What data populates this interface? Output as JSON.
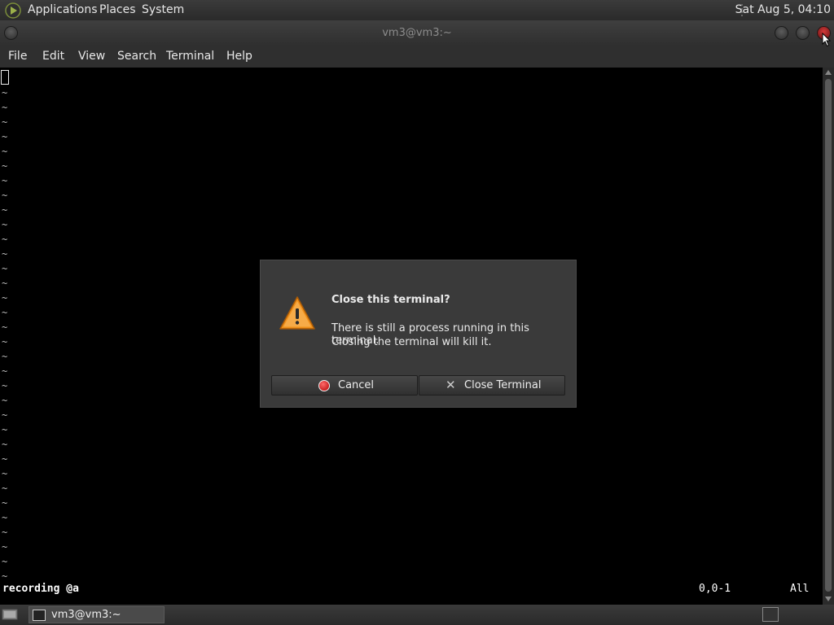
{
  "top_panel": {
    "menus": [
      "Applications",
      "Places",
      "System"
    ],
    "clock": "Sat Aug  5, 04:10",
    "logo_icon": "distro-logo-icon"
  },
  "window": {
    "title": "vm3@vm3:~",
    "menubar": [
      "File",
      "Edit",
      "View",
      "Search",
      "Terminal",
      "Help"
    ]
  },
  "terminal": {
    "tilde": "~",
    "tilde_rows": 34,
    "status_left": "recording @a",
    "status_position": "0,0-1",
    "status_scroll": "All"
  },
  "dialog": {
    "heading": "Close this terminal?",
    "message_line1": "There is still a process running in this terminal.",
    "message_line2": "Closing the terminal will kill it.",
    "cancel_label": "Cancel",
    "close_label": "Close Terminal",
    "icon": "warning-icon"
  },
  "taskbar": {
    "task_label": "vm3@vm3:~"
  },
  "colors": {
    "terminal_bg": "#000000",
    "dialog_bg": "#3a3a3a",
    "warning": "#f0901a",
    "close_button": "#c82020"
  }
}
